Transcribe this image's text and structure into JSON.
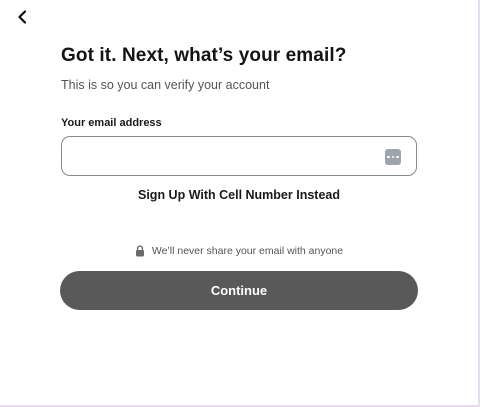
{
  "header": {
    "back_icon": "chevron-left-icon"
  },
  "main": {
    "title": "Got it. Next, what’s your email?",
    "subtitle": "This is so you can verify your account",
    "email_label": "Your email address",
    "email_value": "",
    "email_placeholder": "",
    "autofill_icon": "password-manager-icon",
    "alt_link": "Sign Up With Cell Number Instead",
    "privacy_icon": "lock-icon",
    "privacy_text": "We’ll never share your email with anyone",
    "continue_label": "Continue"
  },
  "colors": {
    "button_bg": "#595959",
    "border": "#8a8a8a",
    "frame_edge": "#e6dcef"
  }
}
